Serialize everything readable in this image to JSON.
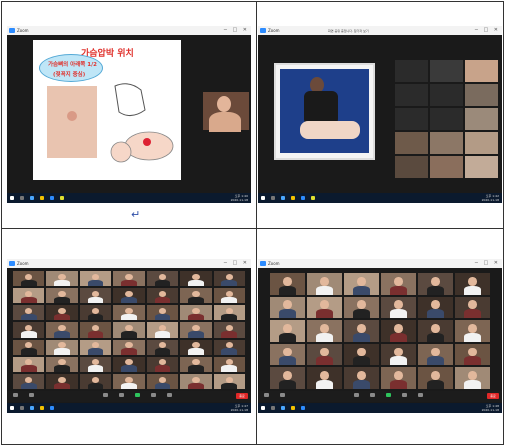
{
  "cell1": {
    "title": "Zoom",
    "slide_title": "가슴압박 위치",
    "bubble_line1": "가슴뼈의 아래쪽 1/2",
    "bubble_line2": "(젖꼭지 중심)",
    "time": "오후 1:40",
    "date": "2020-11-18"
  },
  "cell2": {
    "title": "Zoom",
    "banner": "화면 공유 중입니다. 참가자 보기",
    "time": "오후 1:42",
    "date": "2020-11-18"
  },
  "cell3": {
    "title": "Zoom",
    "end_button": "종료",
    "time": "오후 1:47",
    "date": "2020-11-18"
  },
  "cell4": {
    "title": "Zoom",
    "end_button": "종료",
    "time": "오후 1:48",
    "date": "2020-11-18"
  },
  "return_glyph": "↵",
  "colors": {
    "zoom_blue": "#2d8cff",
    "end_red": "#e02828",
    "taskbar": "#0b1a2e",
    "slide_title_red": "#e0322d"
  },
  "icons": [
    "zoom-icon",
    "windows-start-icon",
    "search-icon",
    "chrome-icon",
    "folder-icon",
    "mic-icon",
    "video-icon",
    "participants-icon",
    "share-screen-icon",
    "chat-icon",
    "record-icon",
    "reactions-icon"
  ]
}
